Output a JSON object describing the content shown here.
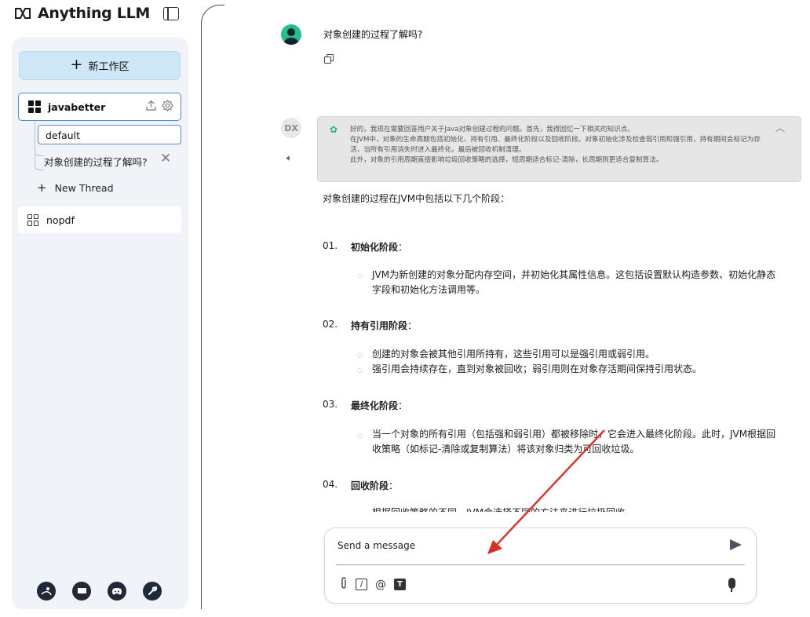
{
  "app": {
    "brand": "Anything LLM"
  },
  "sidebar": {
    "new_workspace_label": "新工作区",
    "workspaces": [
      {
        "name": "javabetter",
        "active": true
      },
      {
        "name": "nopdf",
        "active": false
      }
    ],
    "threads": [
      {
        "label": "default",
        "active": true
      },
      {
        "label": "对象创建的过程了解吗?"
      }
    ],
    "new_thread_label": "New Thread",
    "footer_icons": [
      "community-icon",
      "docs-icon",
      "discord-icon",
      "settings-wrench-icon"
    ]
  },
  "chat": {
    "user_message": "对象创建的过程了解吗?",
    "bot_avatar_text": "DX",
    "thinking": {
      "line1": "好的，我现在需要回答用户关于Java对象创建过程的问题。首先，我得回忆一下相关的知识点。",
      "line2": "在JVM中，对象的生命周期包括初始化、持有引用、最终化阶段以及回收阶段。对象初始化涉及检查弱引用和强引用，持有期间会标记为存活，当所有引用消失时进入最终化，最后被回收机制清理。",
      "line3": "此外，对象的引用周期直接影响垃圾回收策略的选择，短周期适合标记-清除，长周期则更适合复制算法。"
    },
    "answer": {
      "intro": "对象创建的过程在JVM中包括以下几个阶段：",
      "steps": [
        {
          "num": "01.",
          "title": "初始化阶段",
          "suffix": "：",
          "bullets": [
            "JVM为新创建的对象分配内存空间，并初始化其属性信息。这包括设置默认构造参数、初始化静态字段和初始化方法调用等。"
          ]
        },
        {
          "num": "02.",
          "title": "持有引用阶段",
          "suffix": "：",
          "bullets": [
            "创建的对象会被其他引用所持有，这些引用可以是强引用或弱引用。",
            "强引用会持续存在，直到对象被回收；弱引用则在对象存活期间保持引用状态。"
          ]
        },
        {
          "num": "03.",
          "title": "最终化阶段",
          "suffix": "：",
          "bullets": [
            "当一个对象的所有引用（包括强和弱引用）都被移除时，它会进入最终化阶段。此时，JVM根据回收策略（如标记-清除或复制算法）将该对象归类为可回收垃圾。"
          ]
        },
        {
          "num": "04.",
          "title": "回收阶段",
          "suffix": "：",
          "bullets": [
            "根据回收策略的不同，JVM会选择不同的方法来进行垃圾回收。"
          ]
        }
      ]
    },
    "input": {
      "placeholder": "Send a message"
    }
  },
  "colors": {
    "accent": "#4f8fd1",
    "new_workspace_bg": "#cde7f6",
    "annotation_arrow": "#d93025",
    "thinking_bg": "#e6e6e6"
  }
}
